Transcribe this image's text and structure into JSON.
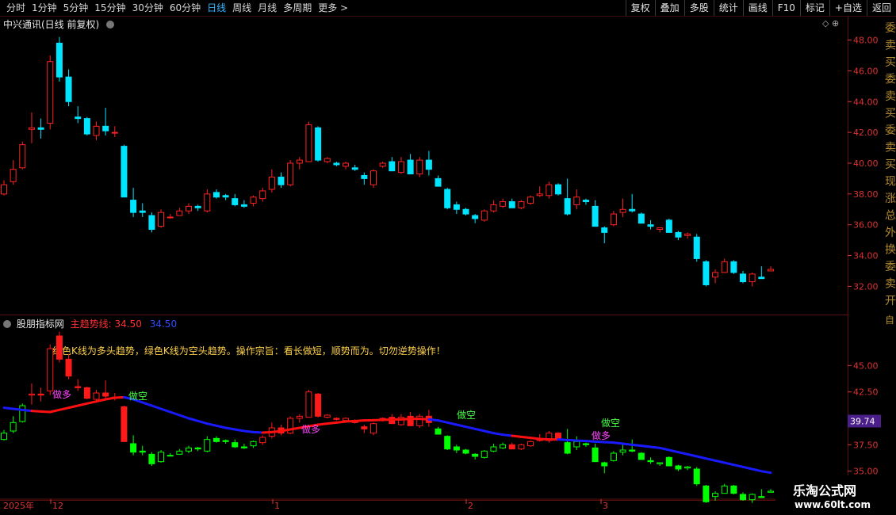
{
  "toolbar": {
    "periods": [
      "分时",
      "1分钟",
      "5分钟",
      "15分钟",
      "30分钟",
      "60分钟",
      "日线",
      "周线",
      "月线",
      "多周期",
      "更多 >"
    ],
    "active_period": "日线",
    "right_buttons": [
      "复权",
      "叠加",
      "多股",
      "统计",
      "画线",
      "F10",
      "标记",
      "+自选",
      "返回"
    ]
  },
  "main_panel": {
    "title": "中兴通讯(日线 前复权)",
    "y_ticks": [
      "48.00",
      "46.00",
      "44.00",
      "42.00",
      "40.00",
      "38.00",
      "36.00",
      "34.00",
      "32.00"
    ],
    "right_glyphs": "委卖买委卖买委卖买现涨总外换委卖开"
  },
  "indicator_panel": {
    "title": "股朋指标网",
    "main_line_label": "主趋势线: 34.50",
    "second_value": "34.50",
    "note": "红色K线为多头趋势，绿色K线为空头趋势。操作宗旨：看长做短，顺势而为。切勿逆势操作！",
    "y_ticks": [
      "45.00",
      "42.50",
      "40.00",
      "37.50",
      "35.00"
    ],
    "current_value": "39.74",
    "signals": [
      {
        "text": "做多",
        "type": "long"
      },
      {
        "text": "做空",
        "type": "short"
      },
      {
        "text": "做多",
        "type": "long"
      },
      {
        "text": "做空",
        "type": "short"
      },
      {
        "text": "做空",
        "type": "short"
      },
      {
        "text": "做多",
        "type": "long"
      }
    ]
  },
  "time_axis": {
    "labels": [
      "2025年",
      "12",
      "1",
      "2",
      "3"
    ]
  },
  "watermark": {
    "line1": "乐淘公式网",
    "line2": "www.60lt.com"
  },
  "colors": {
    "up": "#ff2222",
    "down": "#00e5ff",
    "ind_up": "#ff1a1a",
    "ind_down": "#00ff00",
    "trend_red": "#ff1010",
    "trend_blue": "#1a1aff",
    "grid": "#5a1010",
    "ticks": "#d33"
  },
  "chart_data": {
    "type": "candlestick",
    "note": "daily OHLC, values estimated from axis",
    "ylim_main": [
      31.3,
      48.8
    ],
    "ylim_ind": [
      32.5,
      47.5
    ],
    "candles": [
      [
        38.0,
        38.9,
        37.9,
        38.6
      ],
      [
        38.8,
        40.2,
        38.6,
        39.6
      ],
      [
        39.7,
        41.4,
        39.6,
        41.2
      ],
      [
        42.2,
        43.3,
        41.3,
        42.3
      ],
      [
        42.3,
        42.9,
        41.6,
        42.2
      ],
      [
        42.6,
        47.0,
        42.2,
        46.6
      ],
      [
        47.8,
        48.2,
        45.3,
        45.6
      ],
      [
        45.6,
        46.1,
        43.7,
        44.0
      ],
      [
        43.0,
        43.7,
        42.6,
        42.9
      ],
      [
        42.9,
        43.0,
        41.8,
        41.9
      ],
      [
        41.8,
        42.7,
        41.5,
        42.4
      ],
      [
        42.4,
        43.6,
        41.8,
        42.1
      ],
      [
        42.0,
        42.4,
        41.7,
        42.0
      ],
      [
        41.1,
        41.2,
        37.8,
        37.8
      ],
      [
        37.6,
        38.4,
        36.5,
        36.8
      ],
      [
        36.9,
        37.4,
        36.5,
        36.8
      ],
      [
        36.6,
        36.8,
        35.5,
        35.7
      ],
      [
        35.9,
        37.0,
        35.8,
        36.8
      ],
      [
        36.5,
        36.7,
        36.4,
        36.5
      ],
      [
        36.6,
        37.1,
        36.6,
        36.9
      ],
      [
        36.9,
        37.4,
        36.7,
        37.2
      ],
      [
        37.2,
        37.3,
        36.9,
        37.1
      ],
      [
        36.9,
        38.3,
        36.8,
        38.0
      ],
      [
        38.1,
        38.3,
        37.7,
        37.8
      ],
      [
        37.9,
        38.0,
        37.6,
        37.8
      ],
      [
        37.7,
        38.0,
        37.2,
        37.3
      ],
      [
        37.3,
        37.6,
        37.1,
        37.2
      ],
      [
        37.4,
        37.9,
        37.2,
        37.8
      ],
      [
        37.7,
        38.4,
        37.5,
        38.2
      ],
      [
        38.3,
        39.6,
        38.1,
        39.1
      ],
      [
        39.1,
        39.4,
        38.4,
        38.6
      ],
      [
        38.6,
        40.2,
        38.5,
        40.0
      ],
      [
        40.0,
        40.4,
        39.6,
        40.2
      ],
      [
        40.1,
        42.7,
        40.1,
        42.5
      ],
      [
        42.3,
        42.4,
        40.1,
        40.2
      ],
      [
        40.1,
        40.4,
        40.0,
        40.3
      ],
      [
        40.0,
        40.1,
        39.8,
        39.9
      ],
      [
        39.8,
        40.1,
        39.6,
        40.0
      ],
      [
        39.7,
        39.9,
        39.5,
        39.6
      ],
      [
        39.2,
        39.4,
        38.6,
        39.0
      ],
      [
        38.6,
        39.6,
        38.4,
        39.5
      ],
      [
        39.8,
        40.1,
        39.7,
        40.0
      ],
      [
        40.1,
        40.4,
        39.6,
        39.5
      ],
      [
        39.4,
        40.4,
        39.3,
        40.1
      ],
      [
        40.2,
        40.6,
        39.5,
        39.3
      ],
      [
        39.3,
        40.4,
        39.1,
        40.2
      ],
      [
        40.2,
        40.8,
        39.2,
        39.6
      ],
      [
        39.0,
        39.2,
        38.6,
        38.5
      ],
      [
        38.3,
        38.4,
        37.0,
        37.1
      ],
      [
        37.3,
        37.5,
        36.7,
        37.0
      ],
      [
        37.0,
        37.1,
        36.6,
        36.7
      ],
      [
        36.6,
        36.7,
        36.1,
        36.4
      ],
      [
        36.3,
        37.0,
        36.2,
        36.9
      ],
      [
        36.9,
        37.6,
        36.8,
        37.3
      ],
      [
        37.2,
        37.7,
        37.1,
        37.5
      ],
      [
        37.5,
        37.7,
        37.1,
        37.1
      ],
      [
        37.1,
        37.6,
        37.0,
        37.5
      ],
      [
        37.4,
        37.9,
        37.3,
        37.8
      ],
      [
        37.9,
        38.5,
        37.8,
        38.0
      ],
      [
        37.9,
        38.8,
        37.7,
        38.6
      ],
      [
        38.6,
        38.7,
        37.9,
        38.0
      ],
      [
        37.7,
        39.0,
        36.6,
        36.7
      ],
      [
        37.3,
        38.3,
        37.0,
        37.8
      ],
      [
        37.6,
        37.7,
        37.3,
        37.5
      ],
      [
        37.2,
        37.6,
        36.2,
        35.9
      ],
      [
        35.8,
        35.9,
        34.8,
        35.5
      ],
      [
        36.0,
        36.9,
        35.9,
        36.7
      ],
      [
        36.8,
        37.7,
        36.5,
        37.0
      ],
      [
        37.0,
        38.0,
        36.8,
        36.9
      ],
      [
        36.7,
        36.8,
        36.1,
        36.1
      ],
      [
        36.0,
        36.3,
        35.7,
        35.9
      ],
      [
        35.7,
        35.8,
        35.5,
        35.8
      ],
      [
        36.3,
        36.4,
        35.6,
        35.5
      ],
      [
        35.5,
        35.6,
        35.0,
        35.2
      ],
      [
        35.3,
        35.5,
        35.1,
        35.4
      ],
      [
        35.2,
        35.4,
        33.6,
        33.8
      ],
      [
        33.6,
        33.7,
        32.0,
        32.1
      ],
      [
        32.6,
        33.1,
        32.2,
        32.9
      ],
      [
        32.9,
        33.8,
        32.9,
        33.6
      ],
      [
        33.6,
        33.7,
        32.8,
        32.9
      ],
      [
        32.8,
        33.0,
        32.2,
        32.3
      ],
      [
        32.3,
        32.9,
        32.0,
        32.8
      ],
      [
        32.6,
        33.3,
        32.5,
        32.5
      ],
      [
        33.0,
        33.3,
        33.0,
        33.1
      ]
    ],
    "trend_line": {
      "red_segments": [
        [
          3,
          13
        ],
        [
          28,
          46
        ],
        [
          55,
          60
        ]
      ],
      "values": [
        41.0,
        40.9,
        40.8,
        40.7,
        40.65,
        40.6,
        40.8,
        41.0,
        41.2,
        41.4,
        41.6,
        41.8,
        41.95,
        42.0,
        41.8,
        41.5,
        41.2,
        40.9,
        40.6,
        40.3,
        40.0,
        39.75,
        39.5,
        39.3,
        39.1,
        38.95,
        38.8,
        38.7,
        38.65,
        38.7,
        38.8,
        38.95,
        39.1,
        39.25,
        39.4,
        39.5,
        39.6,
        39.7,
        39.75,
        39.8,
        39.82,
        39.85,
        39.9,
        39.9,
        39.95,
        39.95,
        39.9,
        39.8,
        39.6,
        39.4,
        39.2,
        39.0,
        38.8,
        38.6,
        38.45,
        38.35,
        38.25,
        38.15,
        38.05,
        38.0,
        38.0,
        37.95,
        37.9,
        37.85,
        37.8,
        37.75,
        37.7,
        37.6,
        37.5,
        37.4,
        37.3,
        37.2,
        37.0,
        36.8,
        36.6,
        36.4,
        36.2,
        36.0,
        35.8,
        35.6,
        35.4,
        35.2,
        35.0,
        34.85
      ]
    }
  }
}
